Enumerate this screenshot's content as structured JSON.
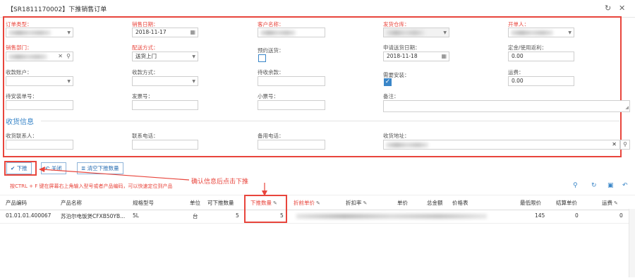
{
  "window": {
    "title": "【SR1811170002】下推销售订单",
    "refresh_icon": "refresh-icon",
    "close_icon": "close-icon"
  },
  "form": {
    "order_type": {
      "label": "订单类型：",
      "value": ""
    },
    "sale_date": {
      "label": "销售日期：",
      "value": "2018-11-17"
    },
    "customer": {
      "label": "客户名称：",
      "value": ""
    },
    "warehouse": {
      "label": "发货仓库：",
      "value": ""
    },
    "creator": {
      "label": "开单人：",
      "value": ""
    },
    "sales_dept": {
      "label": "销售部门：",
      "value": ""
    },
    "delivery_method": {
      "label": "配送方式：",
      "value": "送货上门"
    },
    "appointment": {
      "label": "预约送货：",
      "checked": false
    },
    "request_date": {
      "label": "申请送货日期：",
      "value": "2018-11-18"
    },
    "deposit": {
      "label": "定金/使用返利：",
      "value": "0.00"
    },
    "payment_account": {
      "label": "收款账户：",
      "value": ""
    },
    "payment_method": {
      "label": "收款方式：",
      "value": ""
    },
    "pending_amount": {
      "label": "待收余款：",
      "value": ""
    },
    "need_install": {
      "label": "需要安装：",
      "checked": true
    },
    "freight": {
      "label": "运费：",
      "value": "0.00"
    },
    "install_no": {
      "label": "待安装单号：",
      "value": ""
    },
    "invoice_no": {
      "label": "发票号：",
      "value": ""
    },
    "ticket_no": {
      "label": "小票号：",
      "value": ""
    },
    "remark": {
      "label": "备注：",
      "value": ""
    }
  },
  "delivery": {
    "section_title": "收货信息",
    "contact": {
      "label": "收货联系人：",
      "value": ""
    },
    "phone": {
      "label": "联系电话：",
      "value": ""
    },
    "backup_phone": {
      "label": "备用电话：",
      "value": ""
    },
    "address": {
      "label": "收货地址：",
      "value": ""
    }
  },
  "actions": {
    "push_down": "下推",
    "close": "关闭",
    "clear_qty": "清空下推数量"
  },
  "hint": "按CTRL + F 键在屏幕右上角输入型号或者产品编码，可以快速定位到产品",
  "annotation": "确认信息后点击下推",
  "table": {
    "columns": [
      "产品编码",
      "产品名称",
      "规格型号",
      "单位",
      "可下推数量",
      "下推数量",
      "折前单价",
      "折扣率",
      "单价",
      "总金额",
      "价格表",
      "最低限价",
      "结算单价",
      "运费"
    ],
    "rows": [
      {
        "code": "01.01.01.400067",
        "name": "苏泊尔电饭煲CFXB50YB...",
        "spec": "5L",
        "unit": "台",
        "available": "5",
        "push_qty": "5",
        "pre_price": "",
        "discount": "",
        "price": "",
        "total": "",
        "price_list": "",
        "min_price": "145",
        "settle_price": "0",
        "freight": "0"
      }
    ]
  },
  "colors": {
    "accent": "#3a86c8",
    "required": "#e8453c"
  }
}
